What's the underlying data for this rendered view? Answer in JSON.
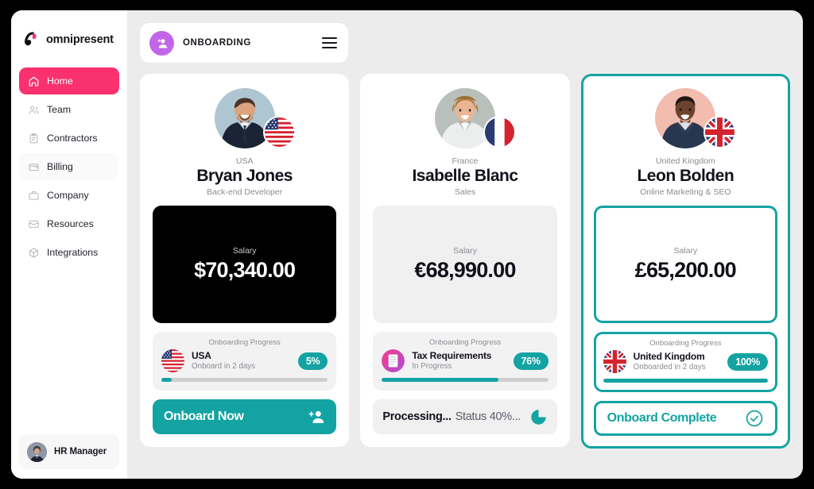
{
  "brand": {
    "name": "omnipresent",
    "accent_pink": "#f9316f",
    "accent_teal": "#14a3a3",
    "accent_purple": "#c266e8"
  },
  "sidebar": {
    "items": [
      {
        "label": "Home",
        "icon": "home-icon",
        "active": true
      },
      {
        "label": "Team",
        "icon": "people-icon",
        "active": false
      },
      {
        "label": "Contractors",
        "icon": "clipboard-icon",
        "active": false
      },
      {
        "label": "Billing",
        "icon": "wallet-icon",
        "active": false
      },
      {
        "label": "Company",
        "icon": "briefcase-icon",
        "active": false
      },
      {
        "label": "Resources",
        "icon": "inbox-icon",
        "active": false
      },
      {
        "label": "Integrations",
        "icon": "cube-icon",
        "active": false
      }
    ],
    "footer": {
      "name": "HR Manager",
      "avatar": "user-avatar"
    }
  },
  "topbar": {
    "icon": "add-person-icon",
    "title": "ONBOARDING",
    "menu_icon": "hamburger-icon"
  },
  "cards": [
    {
      "country": "USA",
      "flag": "flag-usa",
      "name": "Bryan Jones",
      "role": "Back-end Developer",
      "salary_label": "Salary",
      "salary_value": "$70,340.00",
      "salary_style": "dark",
      "selected": false,
      "progress": {
        "title": "Onboarding Progress",
        "icon": "flag-usa",
        "name": "USA",
        "sub": "Onboard in 2 days",
        "percent_label": "5%",
        "percent": 6
      },
      "action": {
        "type": "primary",
        "label": "Onboard Now",
        "icon": "add-person-icon"
      }
    },
    {
      "country": "France",
      "flag": "flag-france",
      "name": "Isabelle Blanc",
      "role": "Sales",
      "salary_label": "Salary",
      "salary_value": "€68,990.00",
      "salary_style": "light",
      "selected": false,
      "progress": {
        "title": "Onboarding Progress",
        "icon": "tax-document-icon",
        "name": "Tax Requirements",
        "sub": "In Progress",
        "percent_label": "76%",
        "percent": 70
      },
      "action": {
        "type": "neutral",
        "label_bold": "Processing...",
        "label_light": "Status 40%...",
        "icon": "pie-spinner-icon"
      }
    },
    {
      "country": "United Kingdom",
      "flag": "flag-uk",
      "name": "Leon Bolden",
      "role": "Online Marketing & SEO",
      "salary_label": "Salary",
      "salary_value": "£65,200.00",
      "salary_style": "outline",
      "selected": true,
      "progress": {
        "title": "Onboarding Progress",
        "icon": "flag-uk",
        "name": "United Kingdom",
        "sub": "Onboarded in 2 days",
        "percent_label": "100%",
        "percent": 100
      },
      "action": {
        "type": "outline",
        "label": "Onboard Complete",
        "icon": "check-circle-icon"
      }
    }
  ]
}
